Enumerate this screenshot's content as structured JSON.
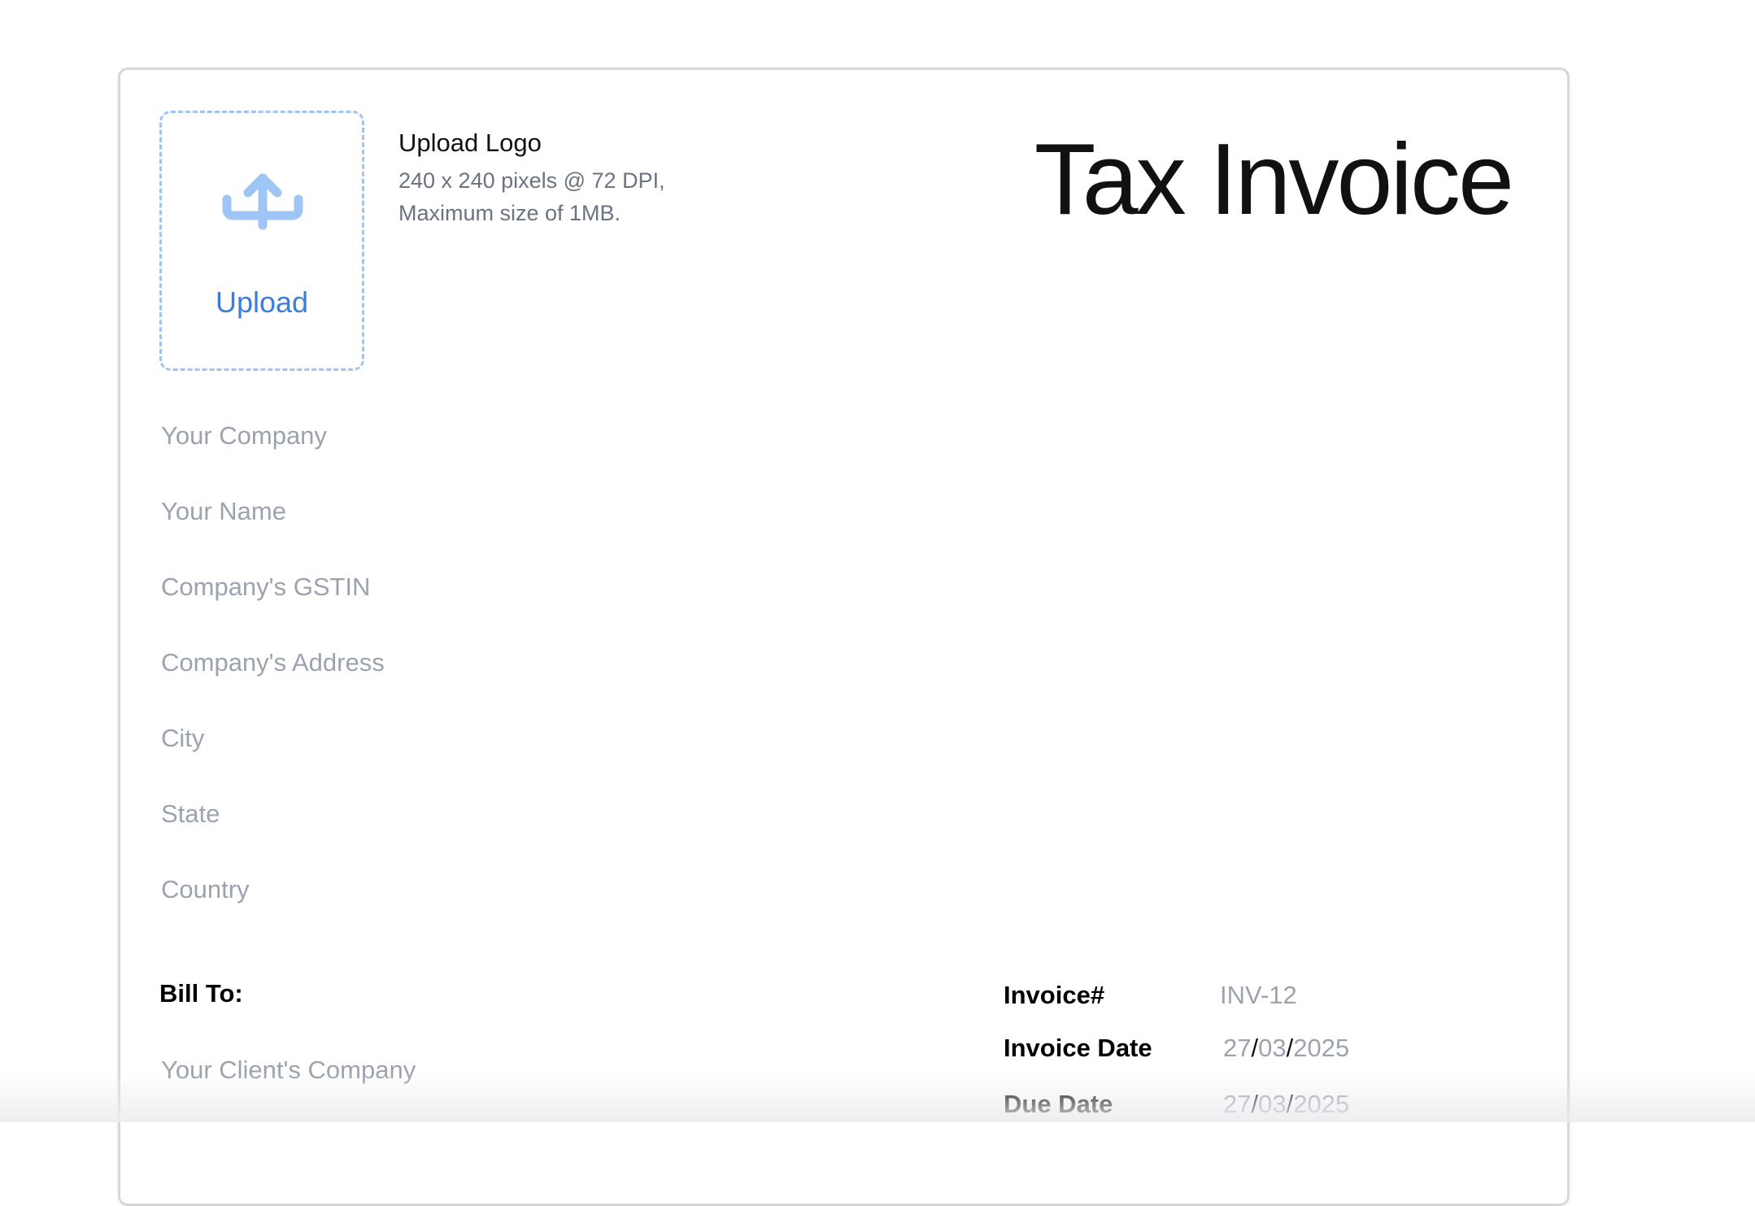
{
  "logo": {
    "upload_label": "Upload",
    "title": "Upload Logo",
    "desc_line1": "240 x 240 pixels @ 72 DPI,",
    "desc_line2": "Maximum size of 1MB."
  },
  "document_title": "Tax Invoice",
  "sender_fields": [
    "Your Company",
    "Your Name",
    "Company's GSTIN",
    "Company's Address",
    "City",
    "State",
    "Country"
  ],
  "bill_to": {
    "label": "Bill To:",
    "client_company_placeholder": "Your Client's Company"
  },
  "invoice_meta": {
    "number_label": "Invoice#",
    "number_value": "INV-12",
    "date_label": "Invoice Date",
    "date": {
      "day": "27",
      "month": "03",
      "year": "2025"
    },
    "due_label": "Due Date",
    "due": {
      "day": "27",
      "month": "03",
      "year": "2025"
    },
    "date_separator": "/"
  },
  "colors": {
    "accent": "#3b7ddd",
    "dashed_border": "#9ec5f3",
    "placeholder": "#9ca3af"
  },
  "icons": {
    "upload": "upload-arrow-tray-icon"
  }
}
